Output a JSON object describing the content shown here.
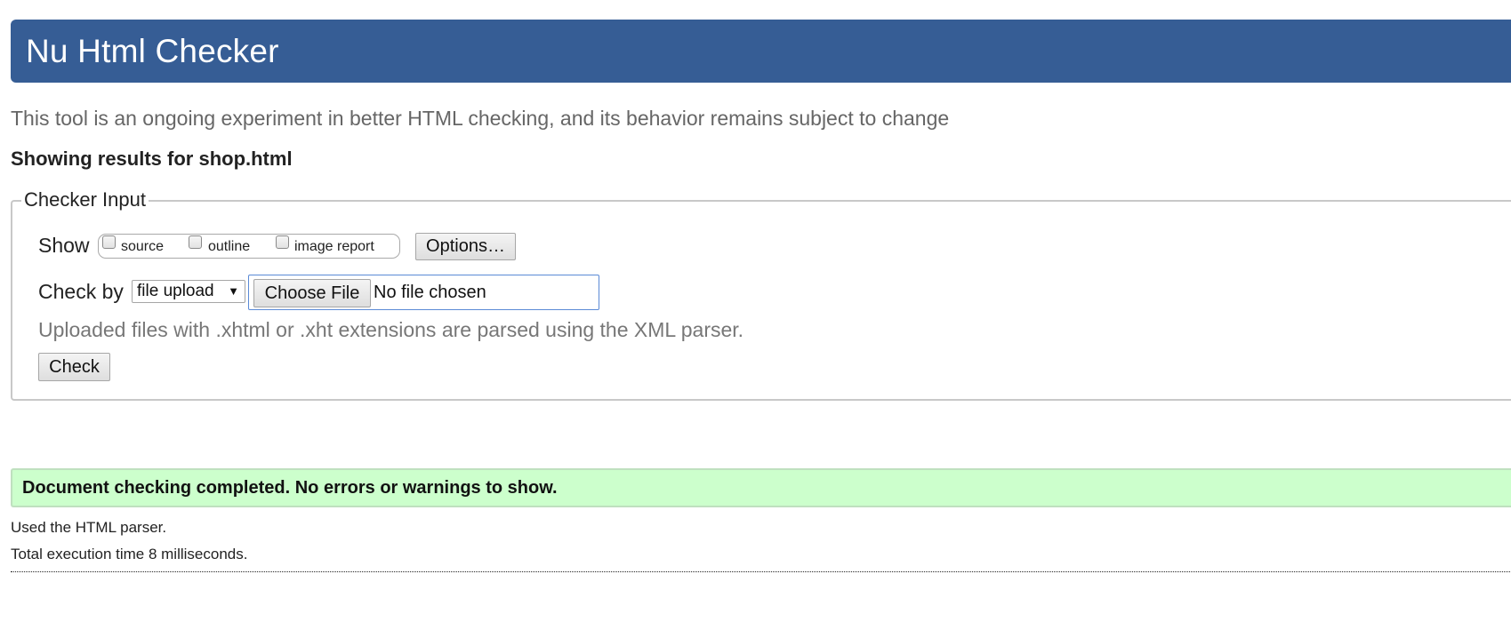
{
  "header": {
    "title": "Nu Html Checker"
  },
  "tagline": "This tool is an ongoing experiment in better HTML checking, and its behavior remains subject to change",
  "results_heading": "Showing results for shop.html",
  "checker_input": {
    "legend": "Checker Input",
    "show_label": "Show",
    "show_options": [
      {
        "label": "source",
        "checked": false
      },
      {
        "label": "outline",
        "checked": false
      },
      {
        "label": "image report",
        "checked": false
      }
    ],
    "options_button": "Options…",
    "check_by_label": "Check by",
    "check_by_selected": "file upload",
    "choose_file_button": "Choose File",
    "file_status": "No file chosen",
    "upload_note": "Uploaded files with .xhtml or .xht extensions are parsed using the XML parser.",
    "check_button": "Check"
  },
  "result": {
    "message": "Document checking completed. No errors or warnings to show.",
    "parser_info": "Used the HTML parser.",
    "execution_time": "Total execution time 8 milliseconds."
  },
  "colors": {
    "header_bg": "#365d95",
    "success_bg": "#ccffcc"
  }
}
